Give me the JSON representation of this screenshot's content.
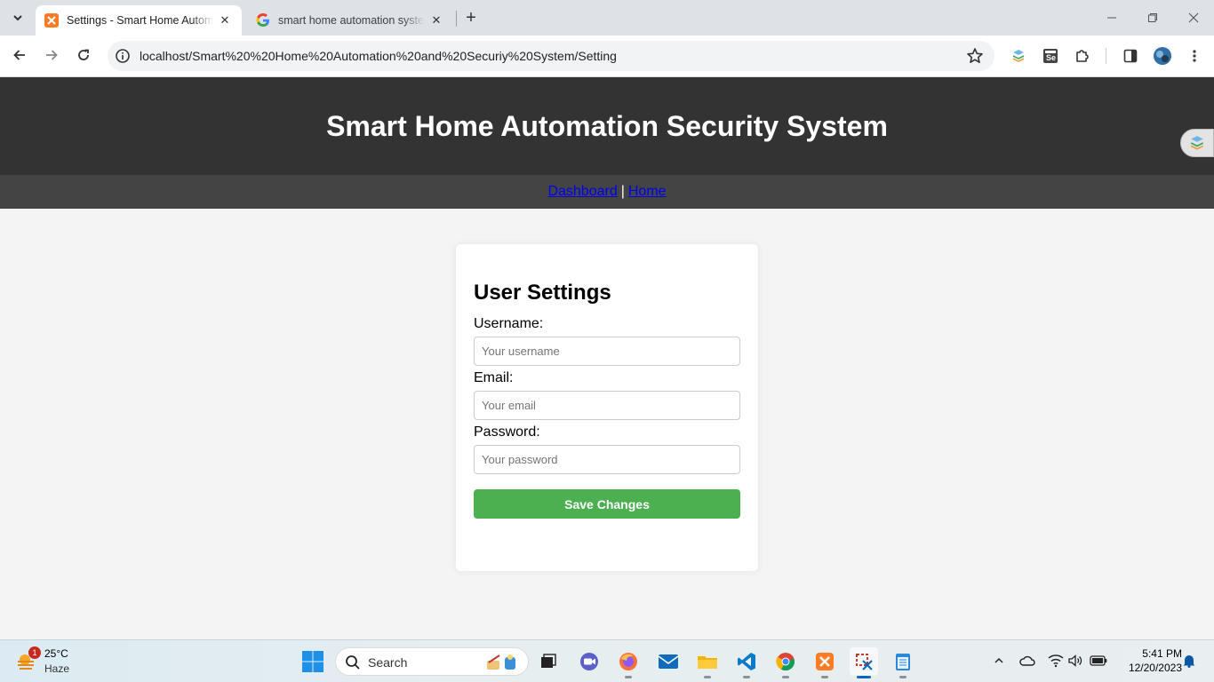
{
  "browser": {
    "tabs": [
      {
        "title": "Settings - Smart Home Automation Security System",
        "active": true
      },
      {
        "title": "smart home automation system",
        "active": false
      }
    ],
    "url": "localhost/Smart%20%20Home%20Automation%20and%20Securiy%20System/Setting"
  },
  "site": {
    "title": "Smart Home Automation Security System",
    "nav": {
      "dashboard": "Dashboard",
      "separator": "|",
      "home": "Home"
    }
  },
  "settings_form": {
    "heading": "User Settings",
    "username_label": "Username:",
    "username_placeholder": "Your username",
    "email_label": "Email:",
    "email_placeholder": "Your email",
    "password_label": "Password:",
    "password_placeholder": "Your password",
    "save_button": "Save Changes"
  },
  "taskbar": {
    "weather": {
      "temp": "25°C",
      "condition": "Haze",
      "badge": "1"
    },
    "search_label": "Search",
    "time": "5:41 PM",
    "date": "12/20/2023"
  },
  "colors": {
    "header_bg": "#333333",
    "nav_bg": "#444444",
    "save_button": "#4caf50",
    "link": "#0000ee"
  }
}
